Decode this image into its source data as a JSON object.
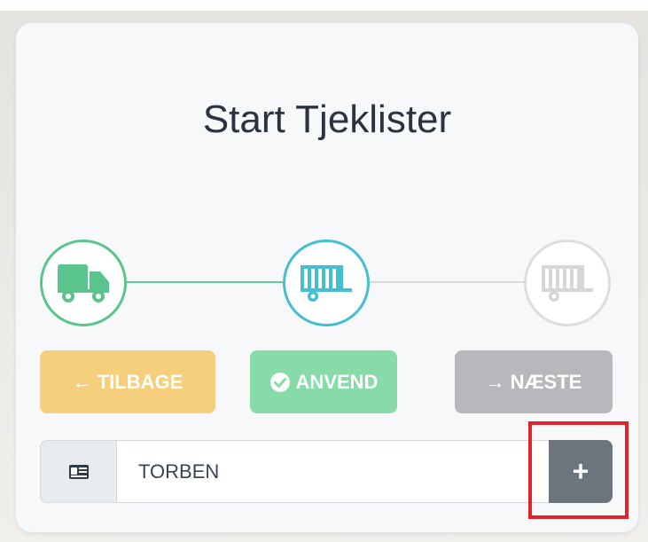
{
  "checklist": {
    "title": "Start Tjeklister"
  },
  "steps": [
    {
      "icon": "truck-icon",
      "state": "completed",
      "color": "#59c58d"
    },
    {
      "icon": "trailer-icon",
      "state": "active",
      "color": "#43bfd0"
    },
    {
      "icon": "trailer-icon",
      "state": "inactive",
      "color": "#dddddd"
    }
  ],
  "actions": {
    "back_arrow": "←",
    "back_label": "TILBAGE",
    "apply_label": "ANVEND",
    "next_arrow": "→",
    "next_label": "NÆSTE"
  },
  "driver": {
    "value": "TORBEN",
    "prepend_icon": "id-card-icon",
    "add_label": "+"
  },
  "colors": {
    "back": "#f6cf7d",
    "apply": "#86dba8",
    "next": "#b6b8bb",
    "add": "#6c757d",
    "highlight": "#e3232b"
  }
}
